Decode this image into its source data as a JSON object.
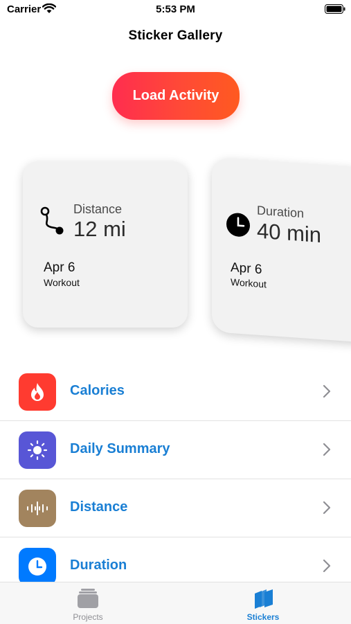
{
  "status": {
    "carrier": "Carrier",
    "time": "5:53 PM"
  },
  "nav": {
    "title": "Sticker Gallery"
  },
  "load_button": {
    "label": "Load Activity"
  },
  "cards": [
    {
      "metric": "Distance",
      "value": "12 mi",
      "date": "Apr 6",
      "sub": "Workout",
      "icon": "route-icon"
    },
    {
      "metric": "Duration",
      "value": "40 min",
      "date": "Apr 6",
      "sub": "Workout",
      "icon": "clock-icon"
    }
  ],
  "list": [
    {
      "label": "Calories",
      "icon": "flame-icon",
      "color": "#ff3b30"
    },
    {
      "label": "Daily Summary",
      "icon": "sun-icon",
      "color": "#5856d6"
    },
    {
      "label": "Distance",
      "icon": "waveform-icon",
      "color": "#a2845e"
    },
    {
      "label": "Duration",
      "icon": "clock-icon",
      "color": "#007aff"
    }
  ],
  "tabs": [
    {
      "label": "Projects",
      "selected": false
    },
    {
      "label": "Stickers",
      "selected": true
    }
  ],
  "colors": {
    "accent": "#1a7fd4",
    "button_start": "#ff2d4f",
    "button_end": "#ff5a20"
  }
}
